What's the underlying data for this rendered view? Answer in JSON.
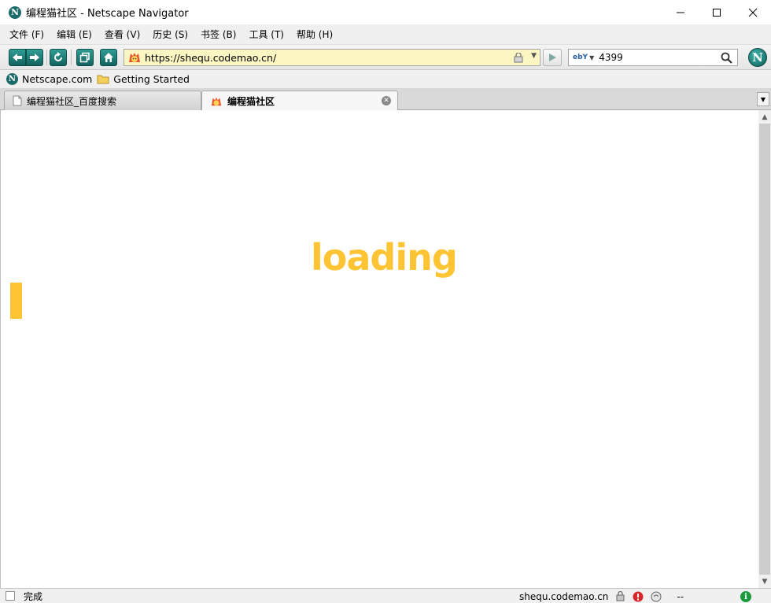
{
  "window": {
    "title": "编程猫社区 - Netscape Navigator",
    "app_icon_letter": "N"
  },
  "menu": {
    "items": [
      "文件 (F)",
      "编辑 (E)",
      "查看 (V)",
      "历史 (S)",
      "书签 (B)",
      "工具 (T)",
      "帮助 (H)"
    ]
  },
  "toolbar": {
    "url": "https://shequ.codemao.cn/",
    "search_engine": "ebY",
    "search_value": "4399",
    "throbber_letter": "N"
  },
  "bookmarks": {
    "items": [
      {
        "label": "Netscape.com",
        "icon": "netscape-icon"
      },
      {
        "label": "Getting Started",
        "icon": "folder-icon"
      }
    ]
  },
  "tabs": [
    {
      "label": "编程猫社区_百度搜索",
      "active": false,
      "icon": "page-icon"
    },
    {
      "label": "编程猫社区",
      "active": true,
      "icon": "codemao-icon"
    }
  ],
  "content": {
    "loading_text": "loading",
    "accent_color": "#fec433"
  },
  "status": {
    "text": "完成",
    "host": "shequ.codemao.cn",
    "extra": "--"
  }
}
